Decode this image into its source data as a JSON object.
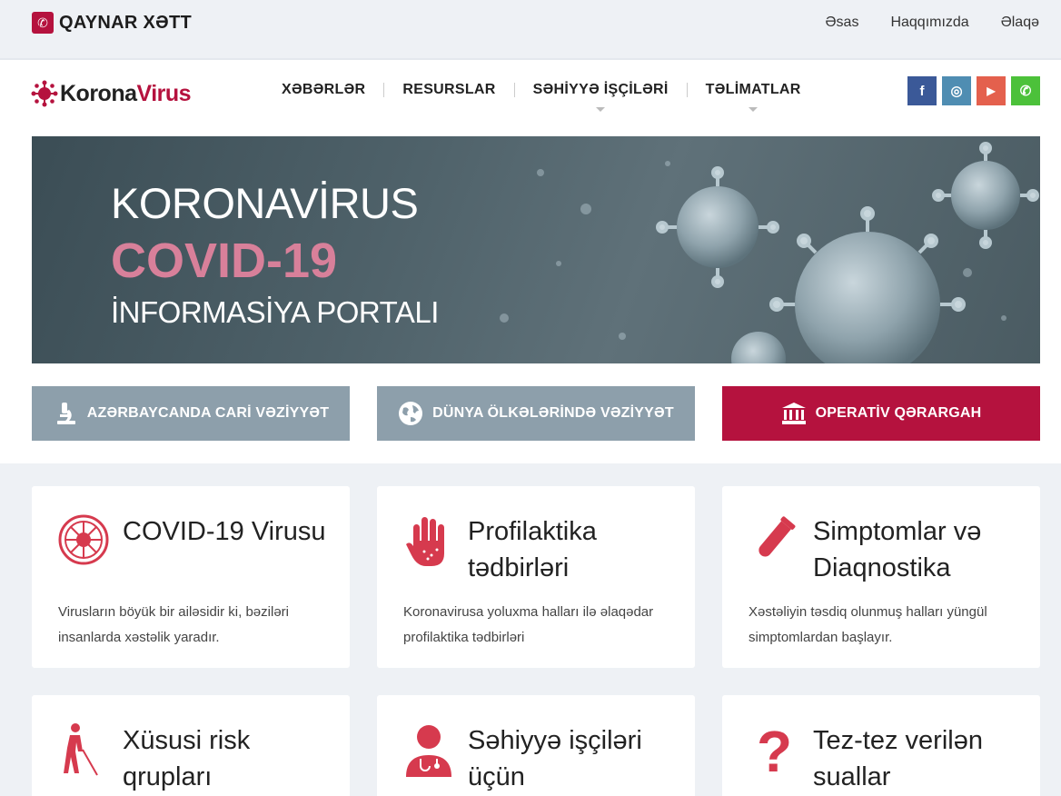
{
  "hotline": {
    "label": "QAYNAR XƏTT"
  },
  "top_links": [
    "Əsas",
    "Haqqımızda",
    "Əlaqə"
  ],
  "logo": {
    "part1": "Korona",
    "part2": "Virus"
  },
  "menu": [
    "XƏBƏRLƏR",
    "RESURSLAR",
    "SƏHİYYƏ İŞÇİLƏRİ",
    "TƏLİMATLAR"
  ],
  "social": {
    "facebook": "f",
    "instagram": "◎",
    "youtube": "▶",
    "whatsapp": "✆"
  },
  "hero": {
    "line1": "KORONAVİRUS",
    "line2": "COVID-19",
    "line3": "İNFORMASİYA PORTALI"
  },
  "buttons": [
    "AZƏRBAYCANDA CARİ VƏZİYYƏT",
    "DÜNYA ÖLKƏLƏRİNDƏ VƏZİYYƏT",
    "OPERATİV QƏRARGAH"
  ],
  "cards": [
    {
      "title": "COVID-19 Virusu",
      "desc": "Virusların böyük bir ailəsidir ki, bəziləri insanlarda xəstəlik yaradır."
    },
    {
      "title": "Profilaktika tədbirləri",
      "desc": "Koronavirusa yoluxma halları ilə əlaqədar profilaktika tədbirləri"
    },
    {
      "title": "Simptomlar və Diaqnostika",
      "desc": "Xəstəliyin təsdiq olunmuş halları yüngül simptomlardan başlayır."
    },
    {
      "title": "Xüsusi risk qrupları",
      "desc": ""
    },
    {
      "title": "Səhiyyə işçiləri üçün",
      "desc": ""
    },
    {
      "title": "Tez-tez verilən suallar",
      "desc": ""
    }
  ],
  "colors": {
    "accent": "#b5123e",
    "button_gray": "#8d9fab",
    "facebook": "#3b5998",
    "instagram": "#4f8db2",
    "youtube": "#e4604d",
    "whatsapp": "#4cc13a"
  }
}
